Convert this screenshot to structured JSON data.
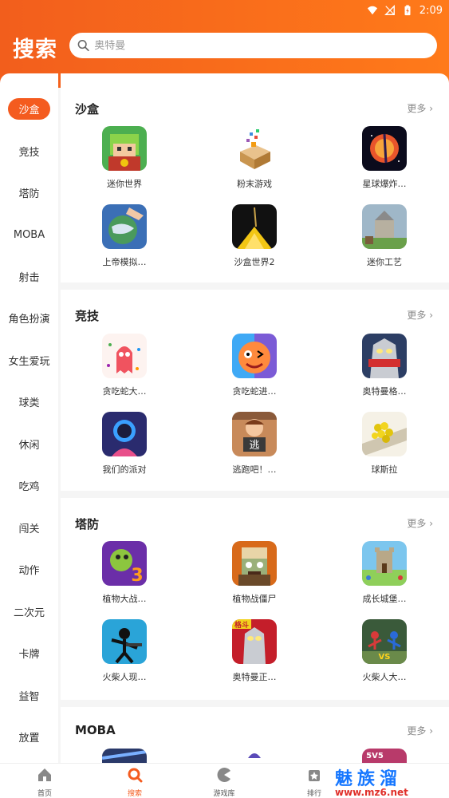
{
  "status_bar": {
    "time": "2:09"
  },
  "header": {
    "title": "搜索",
    "search_placeholder": "奥特曼"
  },
  "sidebar": [
    "沙盒",
    "竞技",
    "塔防",
    "MOBA",
    "射击",
    "角色扮演",
    "女生爱玩",
    "球类",
    "休闲",
    "吃鸡",
    "闯关",
    "动作",
    "二次元",
    "卡牌",
    "益智",
    "放置"
  ],
  "sections": [
    {
      "title": "沙盒",
      "more": "更多",
      "apps": [
        "迷你世界",
        "粉末游戏",
        "星球爆炸…",
        "上帝模拟…",
        "沙盒世界2",
        "迷你工艺"
      ]
    },
    {
      "title": "竞技",
      "more": "更多",
      "apps": [
        "贪吃蛇大…",
        "贪吃蛇进…",
        "奥特曼格…",
        "我们的派对",
        "逃跑吧！…",
        "球斯拉"
      ]
    },
    {
      "title": "塔防",
      "more": "更多",
      "apps": [
        "植物大战…",
        "植物战僵尸",
        "成长城堡…",
        "火柴人现…",
        "奥特曼正…",
        "火柴人大…"
      ]
    },
    {
      "title": "MOBA",
      "more": "更多"
    }
  ],
  "bottom_nav": [
    "首页",
    "搜索",
    "游戏库",
    "排行"
  ],
  "watermark": {
    "text": "魅族溜",
    "url": "www.mz6.net"
  },
  "colors": {
    "accent": "#f45b1f",
    "header": "#f25e1c"
  }
}
